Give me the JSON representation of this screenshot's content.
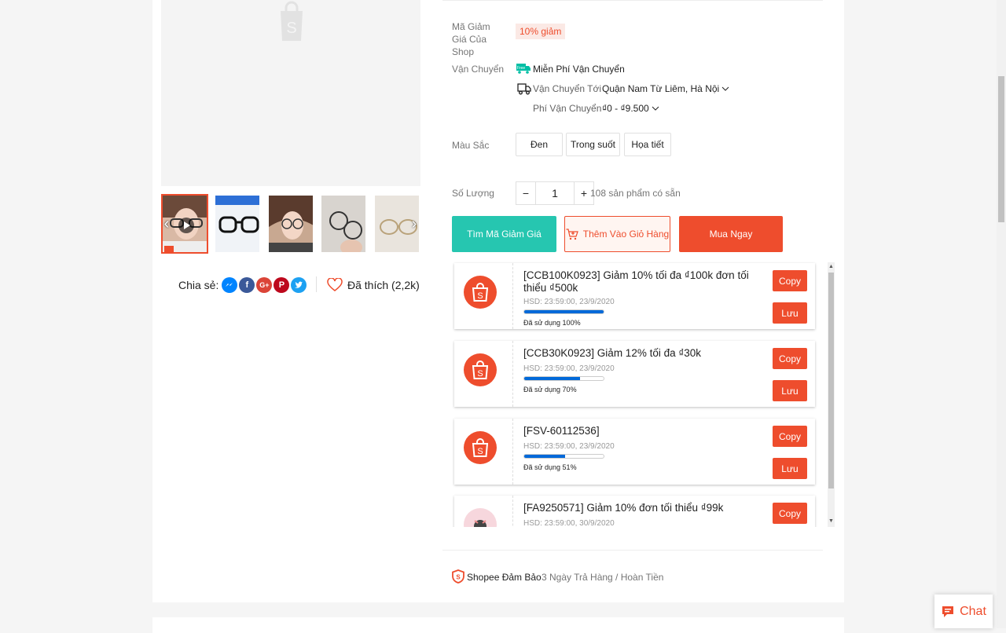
{
  "colors": {
    "accent": "#ee4d2d",
    "teal": "#26c6b0",
    "progress": "#0069d9"
  },
  "share": {
    "label": "Chia sẻ:",
    "networks": [
      "messenger-icon",
      "facebook-icon",
      "google-plus-icon",
      "pinterest-icon",
      "twitter-icon"
    ]
  },
  "favorite": {
    "label": "Đã thích (2,2k)"
  },
  "shop_discount": {
    "label": "Mã Giảm Giá Của Shop",
    "tag": "10% giảm"
  },
  "shipping": {
    "label": "Vận Chuyển",
    "free": "Miễn Phí Vận Chuyển",
    "free_badge": "Free",
    "to_label": "Vận Chuyển Tới",
    "to_value": "Quận Nam Từ Liêm, Hà Nội",
    "fee_label": "Phí Vận Chuyển",
    "fee_value": "₫0 - ₫9.500"
  },
  "color": {
    "label": "Màu Sắc",
    "options": [
      "Đen",
      "Trong suốt",
      "Họa tiết"
    ]
  },
  "quantity": {
    "label": "Số Lượng",
    "value": "1",
    "minus": "−",
    "plus": "+",
    "stock": "108 sản phẩm có sẵn"
  },
  "actions": {
    "find_voucher": "Tìm Mã Giảm Giá",
    "add_to_cart": "Thêm Vào Giỏ Hàng",
    "buy_now": "Mua Ngay"
  },
  "vouchers": [
    {
      "title": "[CCB100K0923] Giảm 10% tối đa ₫100k đơn tối thiểu ₫500k",
      "expiry": "HSD: 23:59:00, 23/9/2020",
      "used_label": "Đã sử dụng 100%",
      "used": 100,
      "copy": "Copy",
      "save": "Lưu"
    },
    {
      "title": "[CCB30K0923] Giảm 12% tối đa ₫30k",
      "expiry": "HSD: 23:59:00, 23/9/2020",
      "used_label": "Đã sử dụng 70%",
      "used": 70,
      "copy": "Copy",
      "save": "Lưu"
    },
    {
      "title": "[FSV-60112536]",
      "expiry": "HSD: 23:59:00, 23/9/2020",
      "used_label": "Đã sử dụng 51%",
      "used": 51,
      "copy": "Copy",
      "save": "Lưu"
    },
    {
      "title": "[FA9250571] Giảm 10% đơn tối thiểu ₫99k",
      "expiry": "HSD: 23:59:00, 30/9/2020",
      "copy": "Copy"
    }
  ],
  "guarantee": {
    "label": "Shopee Đảm Bảo",
    "text": "3 Ngày Trả Hàng / Hoàn Tiền"
  },
  "chat": {
    "label": "Chat"
  }
}
